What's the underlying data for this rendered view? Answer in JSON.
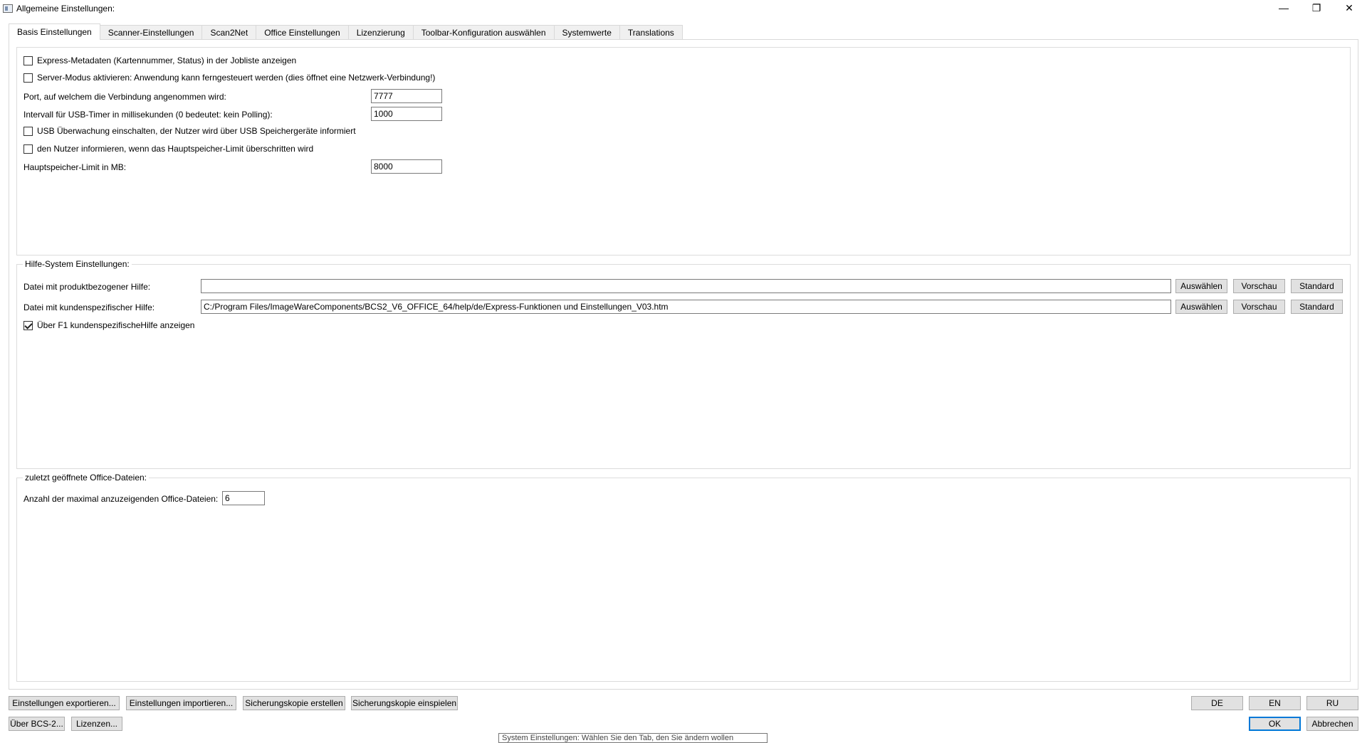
{
  "window": {
    "title": "Allgemeine Einstellungen:",
    "minimize": "—",
    "restore": "❐",
    "close": "✕"
  },
  "tabs": [
    {
      "label": "Basis Einstellungen",
      "active": true
    },
    {
      "label": "Scanner-Einstellungen"
    },
    {
      "label": "Scan2Net"
    },
    {
      "label": "Office Einstellungen"
    },
    {
      "label": "Lizenzierung"
    },
    {
      "label": "Toolbar-Konfiguration auswählen"
    },
    {
      "label": "Systemwerte"
    },
    {
      "label": "Translations"
    }
  ],
  "basic": {
    "express_metadata": {
      "label": "Express-Metadaten (Kartennummer, Status) in der Jobliste anzeigen",
      "checked": false
    },
    "server_mode": {
      "label": "Server-Modus aktivieren: Anwendung kann ferngesteuert werden (dies öffnet eine Netzwerk-Verbindung!)",
      "checked": false
    },
    "port": {
      "label": "Port, auf welchem die Verbindung angenommen wird:",
      "value": "7777"
    },
    "usb_interval": {
      "label": "Intervall für USB-Timer in millisekunden (0 bedeutet: kein Polling):",
      "value": "1000"
    },
    "usb_monitor": {
      "label": "USB Überwachung einschalten, der Nutzer wird über USB Speichergeräte informiert",
      "checked": false
    },
    "memory_notify": {
      "label": "den Nutzer informieren, wenn das Hauptspeicher-Limit überschritten wird",
      "checked": false
    },
    "memory_limit": {
      "label": "Hauptspeicher-Limit in MB:",
      "value": "8000"
    }
  },
  "help": {
    "title": "Hilfe-System Einstellungen:",
    "product_help": {
      "label": "Datei mit produktbezogener Hilfe:",
      "value": ""
    },
    "customer_help": {
      "label": "Datei mit kundenspezifischer Hilfe:",
      "value": "C:/Program Files/ImageWareComponents/BCS2_V6_OFFICE_64/help/de/Express-Funktionen und Einstellungen_V03.htm"
    },
    "select_label": "Auswählen",
    "preview_label": "Vorschau",
    "default_label": "Standard",
    "f1_option": {
      "label": "Über F1 kundenspezifischeHilfe anzeigen",
      "checked": true
    }
  },
  "office": {
    "title": "zuletzt geöffnete Office-Dateien:",
    "max_files": {
      "label": "Anzahl der maximal anzuzeigenden Office-Dateien:",
      "value": "6"
    }
  },
  "footer": {
    "export": "Einstellungen exportieren...",
    "import": "Einstellungen importieren...",
    "backup_create": "Sicherungskopie erstellen",
    "backup_restore": "Sicherungskopie einspielen",
    "about": "Über BCS-2...",
    "licenses": "Lizenzen...",
    "lang_de": "DE",
    "lang_en": "EN",
    "lang_ru": "RU",
    "ok": "OK",
    "cancel": "Abbrechen"
  },
  "tooltip": "System Einstellungen: Wählen Sie den Tab, den Sie ändern wollen"
}
